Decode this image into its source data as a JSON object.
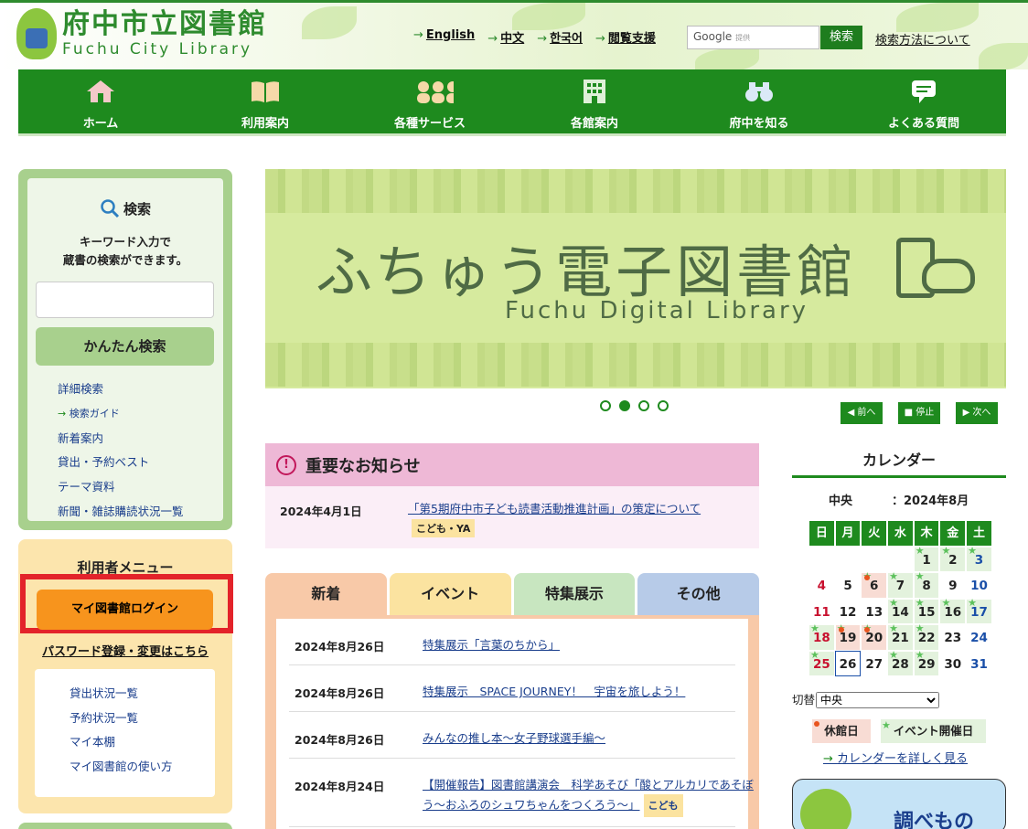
{
  "header": {
    "logo_jp": "府中市立図書館",
    "logo_en": "Fuchu City Library",
    "lang_links": [
      "English",
      "中文",
      "한국어",
      "閲覧支援"
    ],
    "google_label": "Google",
    "google_sub": "提供",
    "search_button": "検索",
    "search_help": "検索方法について"
  },
  "nav": [
    {
      "label": "ホーム",
      "icon": "home-icon"
    },
    {
      "label": "利用案内",
      "icon": "book-icon"
    },
    {
      "label": "各種サービス",
      "icon": "people-icon"
    },
    {
      "label": "各館案内",
      "icon": "building-icon"
    },
    {
      "label": "府中を知る",
      "icon": "binoculars-icon"
    },
    {
      "label": "よくある質問",
      "icon": "speech-icon"
    }
  ],
  "search_panel": {
    "title": "検索",
    "desc_line1": "キーワード入力で",
    "desc_line2": "蔵書の検索ができます。",
    "button": "かんたん検索",
    "links": {
      "detail": "詳細検索",
      "guide": "検索ガイド",
      "new": "新着案内",
      "best": "貸出・予約ベスト",
      "theme": "テーマ資料",
      "news": "新聞・雑誌購読状況一覧"
    }
  },
  "user_menu": {
    "title": "利用者メニュー",
    "login": "マイ図書館ログイン",
    "password": "パスワード登録・変更はこちら",
    "links": [
      "貸出状況一覧",
      "予約状況一覧",
      "マイ本棚",
      "マイ図書館の使い方"
    ]
  },
  "banner": {
    "title": "ふちゅう電子図書館",
    "subtitle": "Fuchu Digital Library",
    "prev": "◀ 前へ",
    "stop": "■ 停止",
    "next": "▶ 次へ",
    "active_slide": 2,
    "slide_count": 4
  },
  "notice": {
    "title": "重要なお知らせ",
    "date": "2024年4月1日",
    "link": "「第5期府中市子ども読書活動推進計画」の策定について",
    "tag": "こども・YA"
  },
  "tabs": [
    "新着",
    "イベント",
    "特集展示",
    "その他"
  ],
  "tab_colors": [
    "#f8c9a8",
    "#fbe3a0",
    "#c8e6c0",
    "#b7cbe8"
  ],
  "news": [
    {
      "date": "2024年8月26日",
      "title": "特集展示「言葉のちから」"
    },
    {
      "date": "2024年8月26日",
      "title": "特集展示　SPACE JOURNEY！　宇宙を旅しよう！"
    },
    {
      "date": "2024年8月26日",
      "title": "みんなの推し本～女子野球選手編～"
    },
    {
      "date": "2024年8月24日",
      "title": "【開催報告】図書館講演会　科学あそび「酸とアルカリであそぼう～おふろのシュワちゃんをつくろう～」",
      "tag": "こども"
    }
  ],
  "calendar": {
    "title": "カレンダー",
    "branch": "中央",
    "month": "：2024年8月",
    "weekdays": [
      "日",
      "月",
      "火",
      "水",
      "木",
      "金",
      "土"
    ],
    "switch_label": "切替",
    "switch_value": "中央",
    "legend_closed": "休館日",
    "legend_event": "イベント開催日",
    "more": "カレンダーを詳しく見る"
  },
  "promo": "調べもの"
}
